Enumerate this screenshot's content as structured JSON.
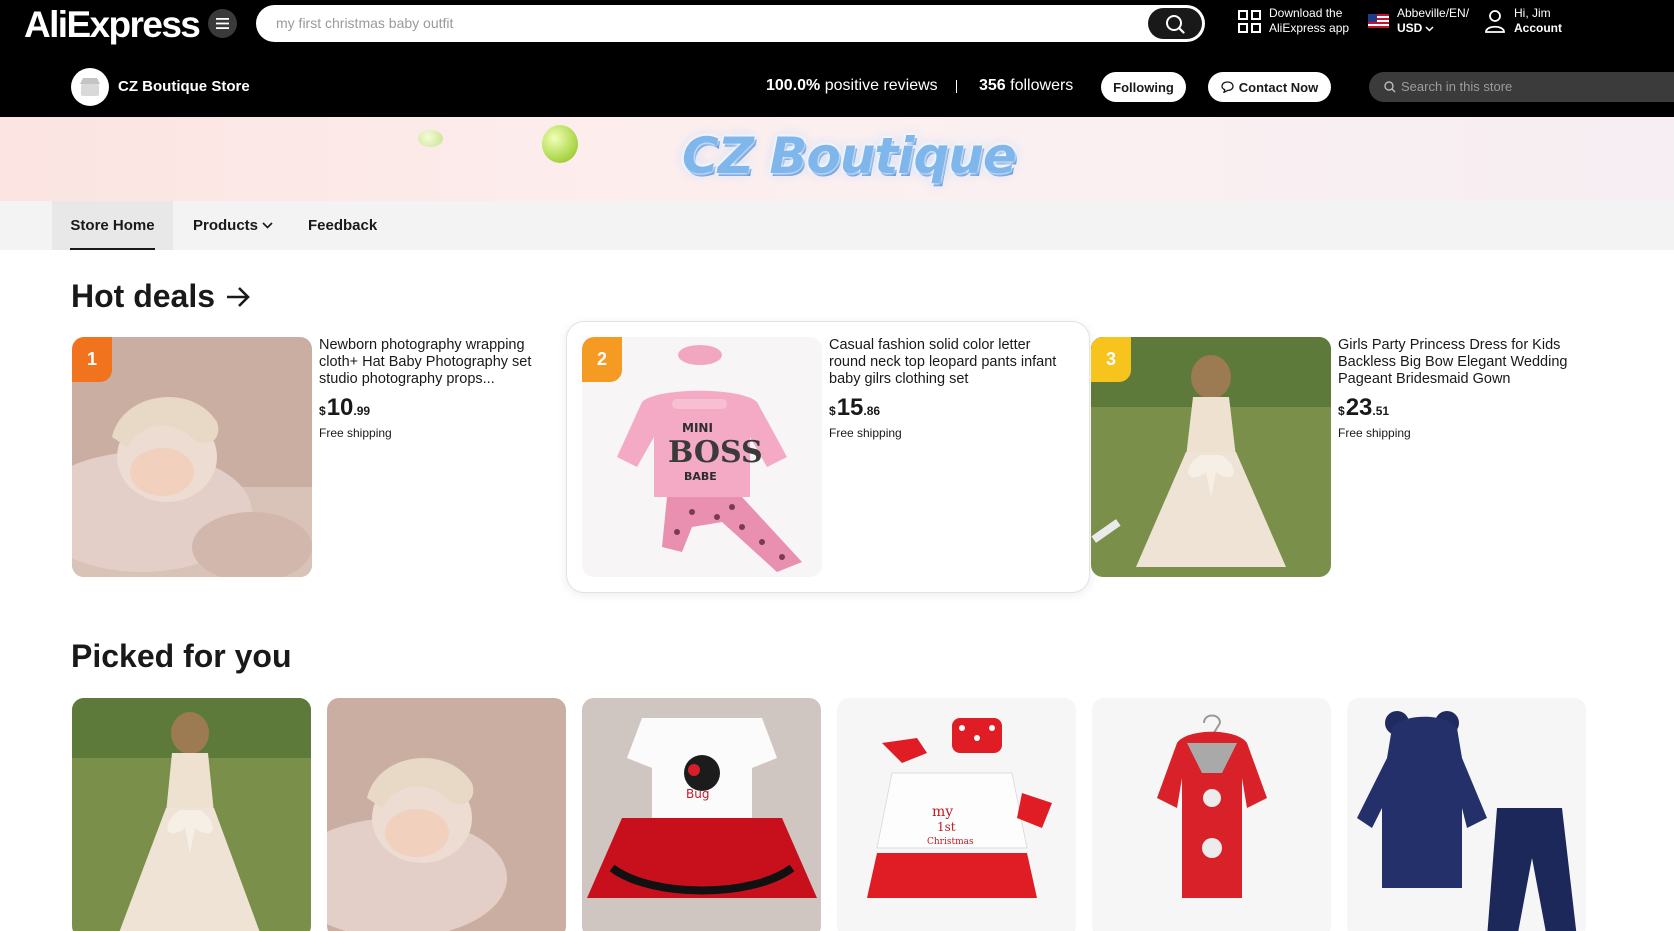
{
  "header": {
    "logo": "AliExpress",
    "search_placeholder": "my first christmas baby outfit",
    "download_line1": "Download the",
    "download_line2": "AliExpress app",
    "locale_line1": "Abbeville/EN/",
    "locale_line2": "USD",
    "account_line1": "Hi, Jim",
    "account_line2": "Account"
  },
  "store": {
    "name": "CZ Boutique Store",
    "reviews_value": "100.0%",
    "reviews_label": "positive reviews",
    "followers_value": "356",
    "followers_label": "followers",
    "following_label": "Following",
    "contact_label": "Contact Now",
    "search_placeholder": "Search in this store"
  },
  "banner": {
    "title": "CZ Boutique"
  },
  "tabs": [
    {
      "label": "Store Home",
      "active": true
    },
    {
      "label": "Products"
    },
    {
      "label": "Feedback"
    }
  ],
  "hot_deals": {
    "title": "Hot deals",
    "items": [
      {
        "rank": "1",
        "rank_color": "#f2731e",
        "title": "Newborn photography wrapping cloth+ Hat Baby Photography set studio photography props...",
        "currency": "$",
        "price_int": "10",
        "price_dec": ".99",
        "shipping": "Free shipping"
      },
      {
        "rank": "2",
        "rank_color": "#f59a23",
        "title": "Casual fashion solid color letter round neck top leopard pants infant baby gilrs clothing set",
        "currency": "$",
        "price_int": "15",
        "price_dec": ".86",
        "shipping": "Free shipping"
      },
      {
        "rank": "3",
        "rank_color": "#f7c31d",
        "title": "Girls Party Princess Dress for Kids Backless Big Bow Elegant Wedding Pageant Bridesmaid Gown Carnival...",
        "currency": "$",
        "price_int": "23",
        "price_dec": ".51",
        "shipping": "Free shipping"
      }
    ]
  },
  "picked": {
    "title": "Picked for you",
    "items": [
      {
        "name": "princess-dress"
      },
      {
        "name": "newborn-wrap"
      },
      {
        "name": "bug-tutu-outfit"
      },
      {
        "name": "my-1st-christmas-set"
      },
      {
        "name": "red-hooded-coat"
      },
      {
        "name": "navy-velvet-set"
      }
    ]
  },
  "colors": {
    "header_bg": "#000000",
    "tab_bar_bg": "#f3f3f3",
    "banner_text": "#7fb7ec"
  }
}
